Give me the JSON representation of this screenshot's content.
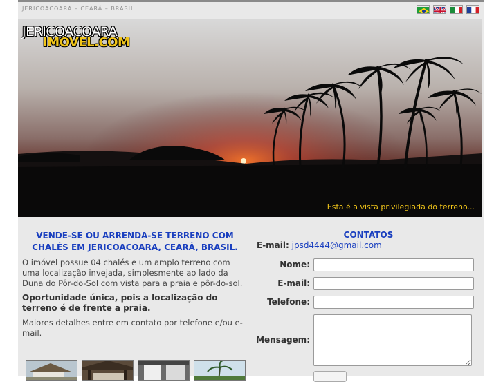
{
  "header": {
    "breadcrumb": "JERICOACOARA – CEARÁ – BRASIL",
    "flags": [
      {
        "name": "brazil-flag-icon"
      },
      {
        "name": "uk-flag-icon"
      },
      {
        "name": "italy-flag-icon"
      },
      {
        "name": "france-flag-icon"
      }
    ]
  },
  "hero": {
    "logo_line1": "JERICOACOARA",
    "logo_line2": "IMOVEL.COM",
    "caption": "Esta é a vista privilegiada do terreno..."
  },
  "main": {
    "headline_line1": "VENDE-SE OU ARRENDA-SE TERRENO COM",
    "headline_line2": "CHALÉS EM JERICOACOARA, CEARÁ, BRASIL.",
    "paragraph1": "O imóvel possue 04 chalés e um amplo terreno com uma localização invejada, simplesmente ao lado da Duna do Pôr-do-Sol com vista para a praia e pôr-do-sol.",
    "paragraph2": "Oportunidade única, pois a localização do terreno é de frente a praia.",
    "paragraph3": "Maiores detalhes entre em contato por telefone e/ou e-mail."
  },
  "contact": {
    "title": "CONTATOS",
    "email_label": "E-mail:",
    "email_value": "jpsd4444@gmail.com",
    "fields": {
      "nome": "Nome:",
      "email": "E-mail:",
      "telefone": "Telefone:",
      "mensagem": "Mensagem:"
    }
  },
  "colors": {
    "accent_blue": "#1a3fbf",
    "logo_yellow": "#f0c419",
    "panel_bg": "#e9e9e9"
  }
}
